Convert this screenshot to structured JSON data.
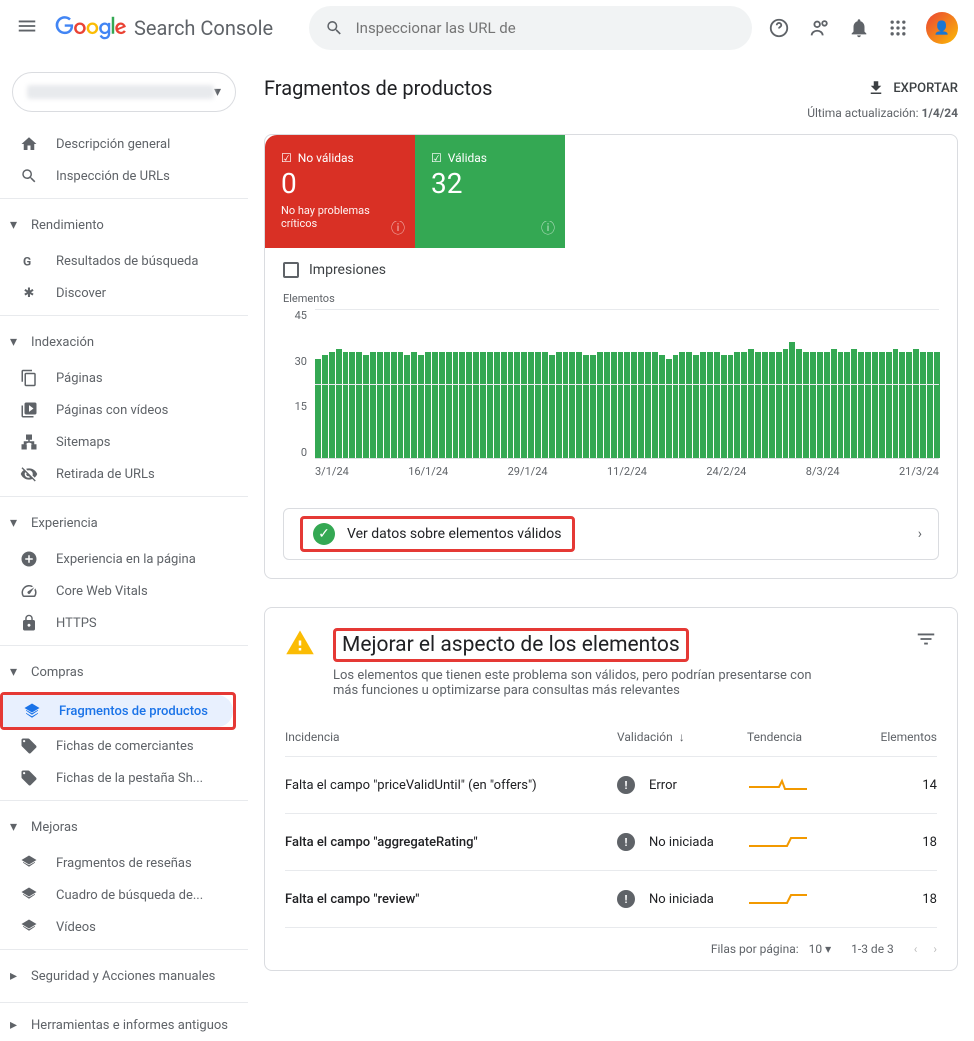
{
  "header": {
    "product_name": "Search Console",
    "search_placeholder": "Inspeccionar las URL de"
  },
  "sidebar": {
    "items": {
      "overview": "Descripción general",
      "url_inspection": "Inspección de URLs",
      "performance_section": "Rendimiento",
      "search_results": "Resultados de búsqueda",
      "discover": "Discover",
      "indexing_section": "Indexación",
      "pages": "Páginas",
      "video_pages": "Páginas con vídeos",
      "sitemaps": "Sitemaps",
      "removals": "Retirada de URLs",
      "experience_section": "Experiencia",
      "page_experience": "Experiencia en la página",
      "core_web_vitals": "Core Web Vitals",
      "https": "HTTPS",
      "shopping_section": "Compras",
      "product_snippets": "Fragmentos de productos",
      "merchant_listings": "Fichas de comerciantes",
      "shopping_tab": "Fichas de la pestaña Sh...",
      "enhancements_section": "Mejoras",
      "review_snippets": "Fragmentos de reseñas",
      "sitelinks_searchbox": "Cuadro de búsqueda de...",
      "videos": "Vídeos",
      "security_section": "Seguridad y Acciones manuales",
      "legacy_section": "Herramientas e informes antiguos"
    }
  },
  "page": {
    "title": "Fragmentos de productos",
    "export": "EXPORTAR",
    "last_updated_label": "Última actualización:",
    "last_updated_value": "1/4/24"
  },
  "status": {
    "invalid_label": "No válidas",
    "invalid_count": "0",
    "invalid_sub": "No hay problemas críticos",
    "valid_label": "Válidas",
    "valid_count": "32"
  },
  "impressions": {
    "label": "Impresiones"
  },
  "chart": {
    "elements_label": "Elementos"
  },
  "valid_link": {
    "text": "Ver datos sobre elementos válidos"
  },
  "improve": {
    "title": "Mejorar el aspecto de los elementos",
    "subtitle": "Los elementos que tienen este problema son válidos, pero podrían presentarse con más funciones u optimizarse para consultas más relevantes"
  },
  "table": {
    "headers": {
      "incidence": "Incidencia",
      "validation": "Validación",
      "trend": "Tendencia",
      "elements": "Elementos"
    },
    "rows": [
      {
        "incidence": "Falta el campo \"priceValidUntil\" (en \"offers\")",
        "validation": "Error",
        "elements": "14"
      },
      {
        "incidence": "Falta el campo \"aggregateRating\"",
        "validation": "No iniciada",
        "elements": "18"
      },
      {
        "incidence": "Falta el campo \"review\"",
        "validation": "No iniciada",
        "elements": "18"
      }
    ],
    "rows_per_page_label": "Filas por página:",
    "rows_per_page_value": "10",
    "range": "1-3 de 3"
  },
  "chart_data": {
    "type": "bar",
    "ylabel": "Elementos",
    "ylim": [
      0,
      45
    ],
    "yticks": [
      0,
      15,
      30,
      45
    ],
    "x_ticks": [
      "3/1/24",
      "16/1/24",
      "29/1/24",
      "11/2/24",
      "24/2/24",
      "8/3/24",
      "21/3/24"
    ],
    "values": [
      30,
      31,
      32,
      33,
      32,
      32,
      32,
      31,
      32,
      32,
      32,
      32,
      32,
      31,
      32,
      31,
      32,
      32,
      32,
      32,
      32,
      32,
      32,
      32,
      32,
      32,
      32,
      32,
      32,
      32,
      32,
      32,
      32,
      32,
      31,
      32,
      32,
      32,
      32,
      31,
      31,
      32,
      32,
      32,
      32,
      32,
      32,
      32,
      32,
      32,
      31,
      30,
      31,
      32,
      32,
      31,
      32,
      32,
      32,
      31,
      31,
      32,
      32,
      33,
      32,
      32,
      32,
      32,
      33,
      35,
      33,
      32,
      32,
      32,
      32,
      33,
      32,
      32,
      33,
      32,
      32,
      32,
      32,
      32,
      33,
      32,
      32,
      33,
      32,
      32,
      32
    ]
  }
}
